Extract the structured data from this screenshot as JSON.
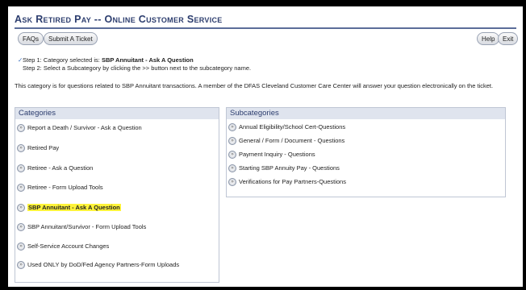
{
  "header": {
    "title": "Ask Retired Pay -- Online Customer Service"
  },
  "toolbar": {
    "faqs_label": "FAQs",
    "submit_label": "Submit A Ticket",
    "help_label": "Help",
    "exit_label": "Exit"
  },
  "steps": {
    "step1_prefix": "Step 1: Category selected is: ",
    "step1_value": "SBP Annuitant - Ask A Question",
    "step2": "Step 2: Select a Subcategory by clicking the >> button next to the subcategory name."
  },
  "description": "This category is for questions related to SBP Annuitant transactions. A member of the DFAS Cleveland Customer Care Center will answer your question electronically on the ticket.",
  "categories": {
    "heading": "Categories",
    "items": [
      "Report a Death / Survivor - Ask a Question",
      "Retired Pay",
      "Retiree - Ask a Question",
      "Retiree - Form Upload Tools",
      "SBP Annuitant - Ask A Question",
      "SBP Annuitant/Survivor - Form Upload Tools",
      "Self-Service Account Changes",
      "Used ONLY by DoD/Fed Agency Partners-Form Uploads"
    ],
    "selected": "SBP Annuitant - Ask A Question"
  },
  "subcategories": {
    "heading": "Subcategories",
    "items": [
      "Annual Eligibility/School Cert-Questions",
      "General / Form / Document - Questions",
      "Payment Inquiry - Questions",
      "Starting SBP Annuity Pay - Questions",
      "Verifications for Pay Partners-Questions"
    ]
  },
  "icons": {
    "item_button": "arrow-button-icon",
    "check": "check-icon"
  },
  "colors": {
    "title": "#2c3d6e",
    "highlight": "#fff33a",
    "panel_header": "#dfe4ee"
  }
}
